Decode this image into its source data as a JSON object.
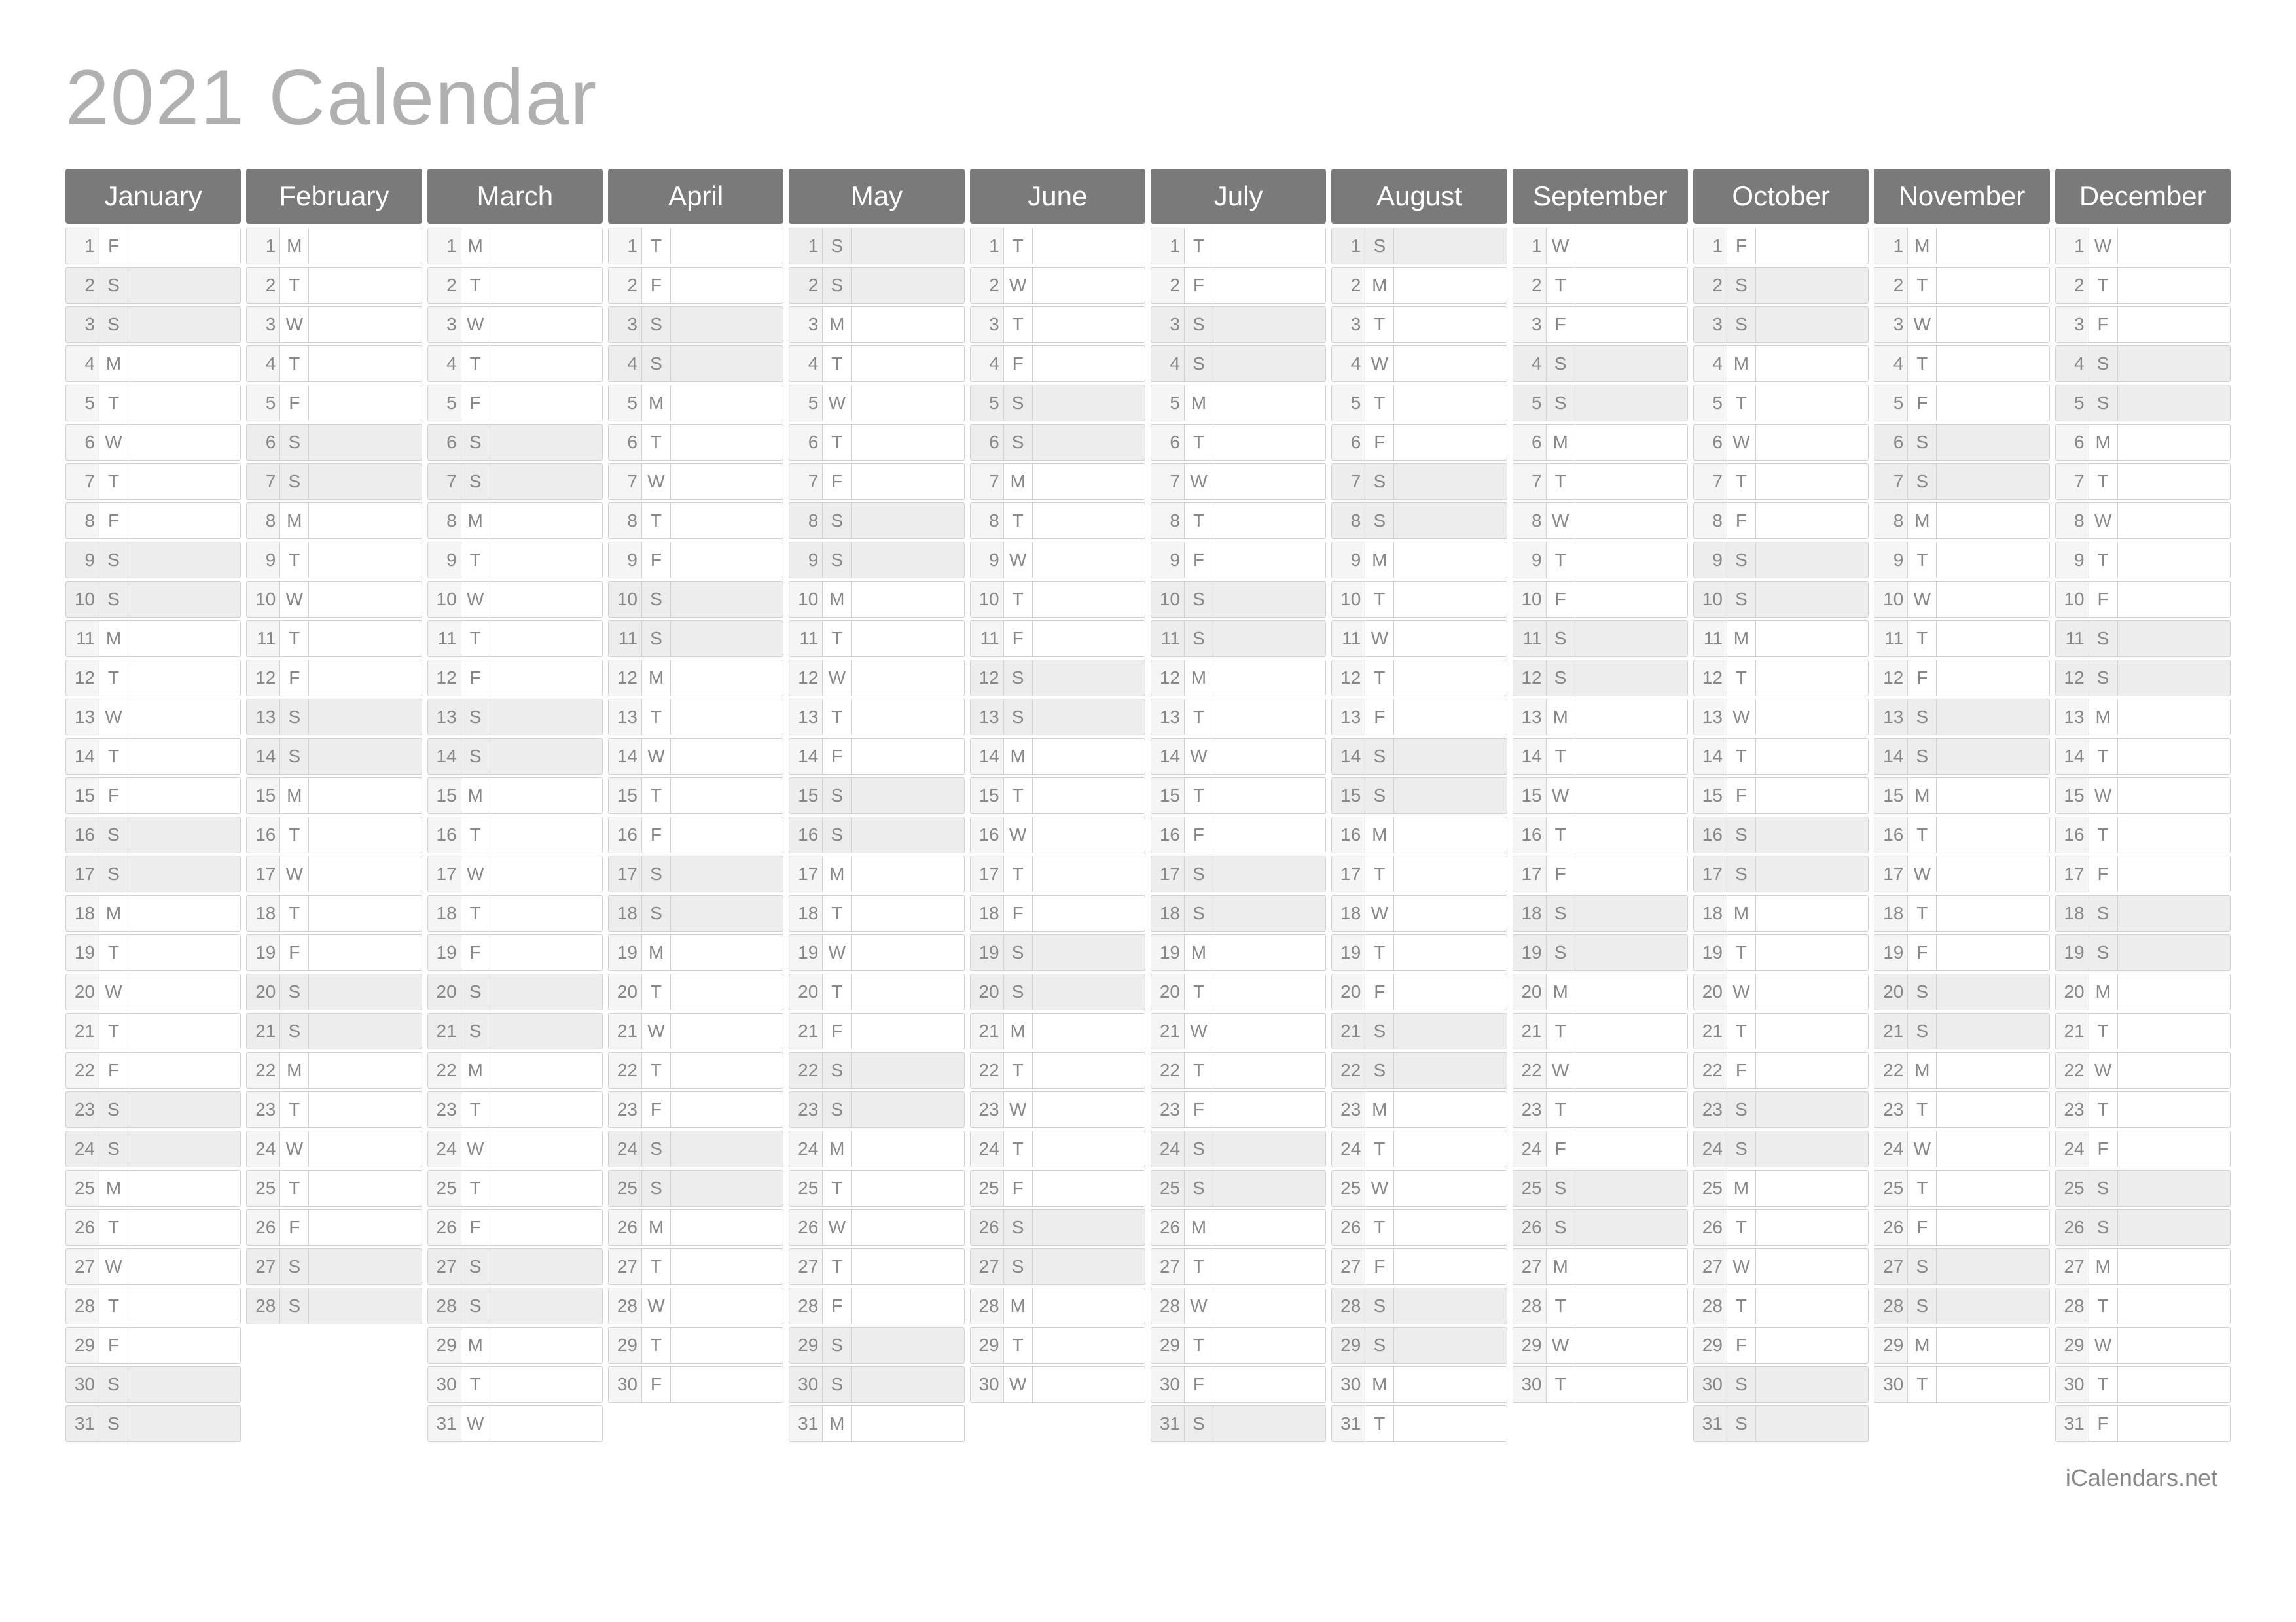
{
  "title": "2021 Calendar",
  "footer": "iCalendars.net",
  "weekdayLetters": [
    "S",
    "M",
    "T",
    "W",
    "T",
    "F",
    "S"
  ],
  "weekendDows": [
    0,
    6
  ],
  "months": [
    {
      "name": "January",
      "days": 31,
      "startDow": 5
    },
    {
      "name": "February",
      "days": 28,
      "startDow": 1
    },
    {
      "name": "March",
      "days": 31,
      "startDow": 1
    },
    {
      "name": "April",
      "days": 30,
      "startDow": 4
    },
    {
      "name": "May",
      "days": 31,
      "startDow": 6
    },
    {
      "name": "June",
      "days": 30,
      "startDow": 2
    },
    {
      "name": "July",
      "days": 31,
      "startDow": 4
    },
    {
      "name": "August",
      "days": 31,
      "startDow": 0
    },
    {
      "name": "September",
      "days": 30,
      "startDow": 3
    },
    {
      "name": "October",
      "days": 31,
      "startDow": 5
    },
    {
      "name": "November",
      "days": 30,
      "startDow": 1
    },
    {
      "name": "December",
      "days": 31,
      "startDow": 3
    }
  ]
}
